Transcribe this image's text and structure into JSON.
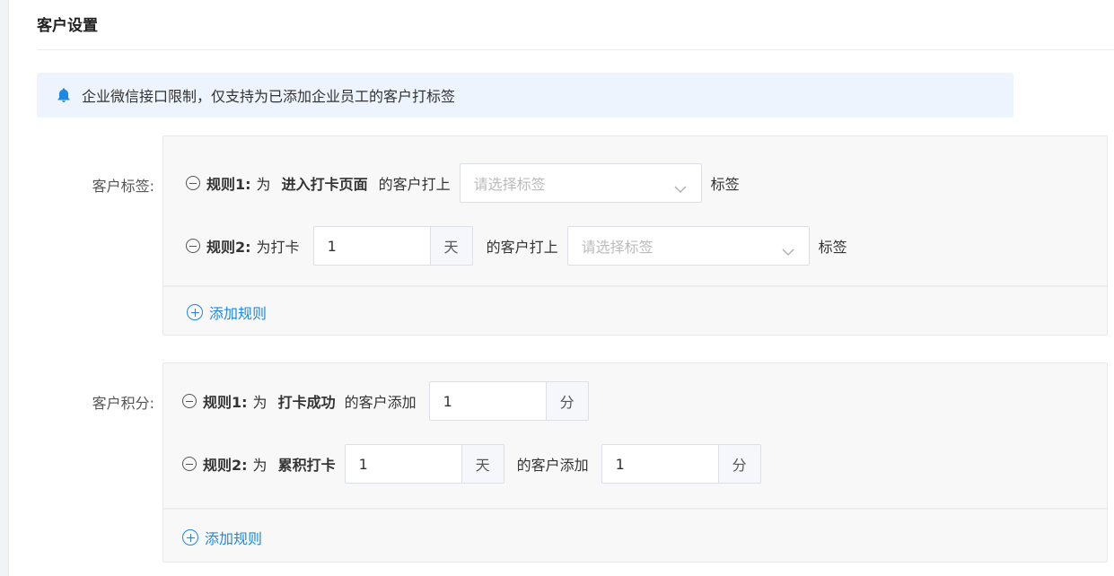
{
  "page": {
    "title": "客户设置"
  },
  "notice": {
    "icon": "bell-icon",
    "text": "企业微信接口限制，仅支持为已添加企业员工的客户打标签",
    "icon_color": "#1e88e5"
  },
  "customer_tags": {
    "label": "客户标签:",
    "rules": [
      {
        "name": "规则1:",
        "prefix": "为",
        "condition": "进入打卡页面",
        "middle": "的客户打上",
        "select_placeholder": "请选择标签",
        "suffix": "标签"
      },
      {
        "name": "规则2:",
        "prefix": "为打卡",
        "days_value": "1",
        "days_unit": "天",
        "middle": "的客户打上",
        "select_placeholder": "请选择标签",
        "suffix": "标签"
      }
    ],
    "add_rule": "添加规则"
  },
  "customer_points": {
    "label": "客户积分:",
    "rules": [
      {
        "name": "规则1:",
        "prefix": "为",
        "condition": "打卡成功",
        "middle": "的客户添加",
        "points_value": "1",
        "points_unit": "分"
      },
      {
        "name": "规则2:",
        "prefix": "为",
        "condition": "累积打卡",
        "days_value": "1",
        "days_unit": "天",
        "middle": "的客户添加",
        "points_value": "1",
        "points_unit": "分"
      }
    ],
    "add_rule": "添加规则"
  },
  "colors": {
    "accent": "#1e88e5",
    "notice_bg": "#edf4fd",
    "panel_bg": "#f8f8f9",
    "border": "#dcdfe6"
  }
}
